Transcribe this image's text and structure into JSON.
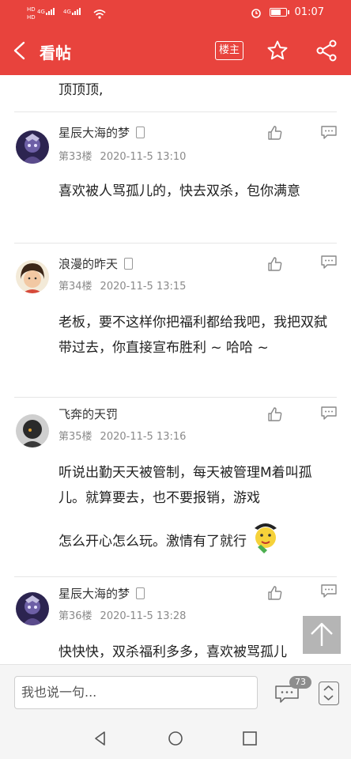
{
  "status_bar": {
    "time": "01:07",
    "network": [
      "HD",
      "4G",
      "4G"
    ],
    "battery_level": 0.7
  },
  "header": {
    "title": "看帖",
    "louzhu_label": "楼主",
    "back_icon": "chevron-left-icon",
    "star_icon": "star-icon",
    "share_icon": "share-icon",
    "background_color": "#e8433d"
  },
  "thread": {
    "previous_fragment": "顶顶顶,",
    "posts": [
      {
        "username": "星辰大海的梦",
        "floor": "第33楼",
        "time": "2020-11-5 13:10",
        "content": "喜欢被人骂孤儿的，快去双杀，包你满意"
      },
      {
        "username": "浪漫的昨天",
        "floor": "第34楼",
        "time": "2020-11-5 13:15",
        "content": "老板，要不这样你把福利都给我吧，我把双弑带过去，你直接宣布胜利 ~ 哈哈 ~"
      },
      {
        "username": "飞奔的天罚",
        "floor": "第35楼",
        "time": "2020-11-5 13:16",
        "content_line1": "听说出勤天天被管制，每天被管理M着叫孤儿。就算要去，也不要报销，游戏",
        "content_line2": "怎么开心怎么玩。激情有了就行"
      },
      {
        "username": "星辰大海的梦",
        "floor": "第36楼",
        "time": "2020-11-5 13:28",
        "content": "快快快，双杀福利多多，喜欢被骂孤儿"
      }
    ]
  },
  "bottom_bar": {
    "input_placeholder": "我也说一句...",
    "comment_count": "73"
  },
  "nav_bar": {
    "back_icon": "triangle-back-icon",
    "home_icon": "circle-home-icon",
    "recent_icon": "square-recent-icon"
  }
}
